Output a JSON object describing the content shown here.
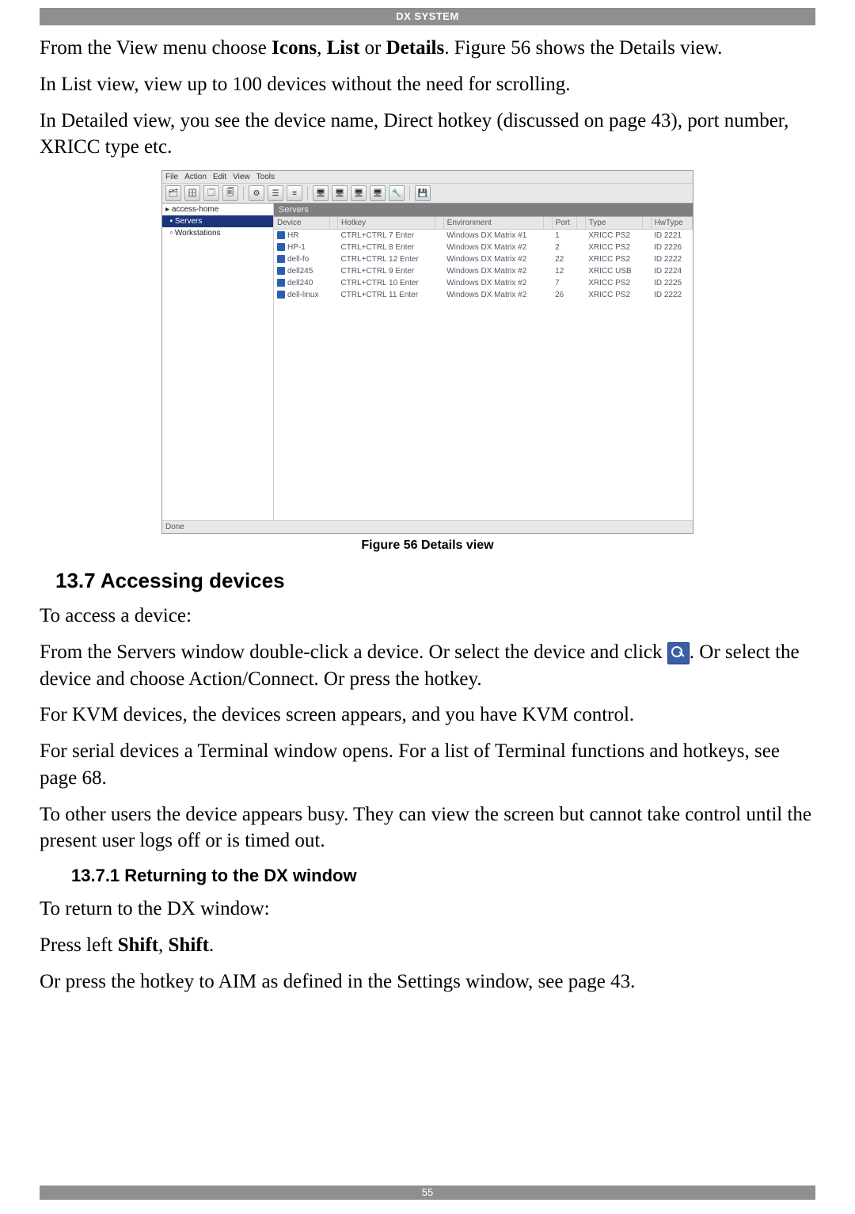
{
  "header_title": "DX SYSTEM",
  "para1_a": "From the View menu choose ",
  "para1_b_icons": "Icons",
  "para1_c": ", ",
  "para1_d_list": "List",
  "para1_e": " or ",
  "para1_f_details": "Details",
  "para1_g": ". Figure 56 shows the Details view.",
  "para2": "In List view, view up to 100 devices without the need for scrolling.",
  "para3": "In Detailed view, you see the device name, Direct hotkey (discussed on page 43), port number, XRICC type etc.",
  "figure": {
    "window_title": "File  Action  Edit  View  Tools",
    "menu": [
      "File",
      "Action",
      "Edit",
      "View",
      "Tools"
    ],
    "tree": {
      "root": "access-home",
      "selected": "Servers",
      "child": "Workstations"
    },
    "pane_title": "Servers",
    "columns": [
      "Device",
      "",
      "Hotkey",
      "",
      "Environment",
      "",
      "Port",
      "",
      "Type",
      "",
      "HwType"
    ],
    "rows": [
      {
        "dev": "HR",
        "hot": "CTRL+CTRL 7 Enter",
        "env": "Windows DX Matrix #1",
        "port": "1",
        "type": "XRICC PS2",
        "hw": "ID 2221"
      },
      {
        "dev": "HP-1",
        "hot": "CTRL+CTRL 8 Enter",
        "env": "Windows DX Matrix #2",
        "port": "2",
        "type": "XRICC PS2",
        "hw": "ID 2226"
      },
      {
        "dev": "dell-fo",
        "hot": "CTRL+CTRL 12 Enter",
        "env": "Windows DX Matrix #2",
        "port": "22",
        "type": "XRICC PS2",
        "hw": "ID 2222"
      },
      {
        "dev": "dell245",
        "hot": "CTRL+CTRL 9 Enter",
        "env": "Windows DX Matrix #2",
        "port": "12",
        "type": "XRICC USB",
        "hw": "ID 2224"
      },
      {
        "dev": "dell240",
        "hot": "CTRL+CTRL 10 Enter",
        "env": "Windows DX Matrix #2",
        "port": "7",
        "type": "XRICC PS2",
        "hw": "ID 2225"
      },
      {
        "dev": "dell-linux",
        "hot": "CTRL+CTRL 11 Enter",
        "env": "Windows DX Matrix #2",
        "port": "26",
        "type": "XRICC PS2",
        "hw": "ID 2222"
      }
    ],
    "status": "Done"
  },
  "figcaption": "Figure 56 Details view",
  "h2": "13.7 Accessing devices",
  "p_access": "To access a device:",
  "p_select_a": "From the Servers window double-click a device. Or select the device and click ",
  "p_select_b": ". Or select the device and choose Action/Connect. Or press the hotkey.",
  "p_kvm": "For KVM devices, the devices screen appears, and you have KVM control.",
  "p_serial": "For serial devices a Terminal window opens. For a list of Terminal functions and hotkeys, see page 68.",
  "p_busy": "To other users the device appears busy. They can view the screen but cannot take control until the present user logs off or is timed out.",
  "h3": "13.7.1 Returning to the DX window",
  "p_return": "To return to the DX window:",
  "p_press_a": "Press left ",
  "p_press_shift1": "Shift",
  "p_press_b": ", ",
  "p_press_shift2": "Shift",
  "p_press_c": ".",
  "p_aim": "Or press the hotkey to AIM as defined in the Settings window, see page 43.",
  "page_number": "55"
}
